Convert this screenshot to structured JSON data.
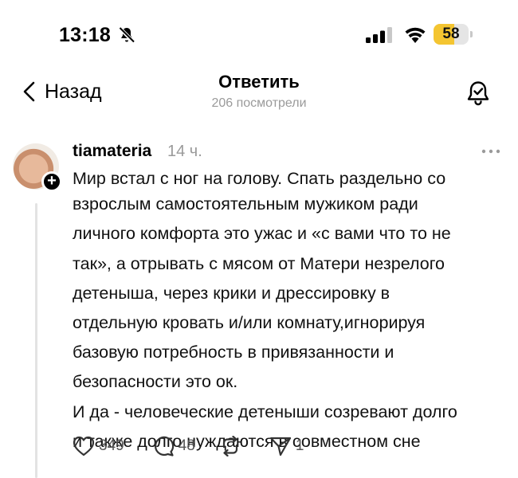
{
  "status_bar": {
    "time": "13:18",
    "battery_level": "58",
    "battery_fraction": 0.58,
    "icons": [
      "bell-off-icon",
      "signal-icon",
      "wifi-icon",
      "battery-icon"
    ]
  },
  "header": {
    "back_label": "Назад",
    "title": "Ответить",
    "subtitle": "206 посмотрели"
  },
  "post": {
    "username": "tiamateria",
    "time": "14 ч.",
    "paragraphs": [
      [
        "Мир встал с ног на голову. Спать раздельно со",
        "взрослым самостоятельным мужиком ради",
        "личного комфорта это ужас и «с вами что то не",
        "так», а отрывать с мясом от Матери незрелого",
        "детеныша, через крики и дрессировку в",
        "отдельную кровать и/или комнату,игнорируя",
        "базовую потребность в привязанности и",
        "безопасности это ок."
      ],
      [
        "И да - человеческие детеныши созревают долго",
        "и также долго нуждаются в совместном сне"
      ]
    ],
    "stats": {
      "likes": "349",
      "replies": "48",
      "shares": "1"
    }
  },
  "colors": {
    "battery_fill": "#f4c531",
    "muted_text": "#9a9a9a",
    "thread_line": "#e3e3e3"
  }
}
